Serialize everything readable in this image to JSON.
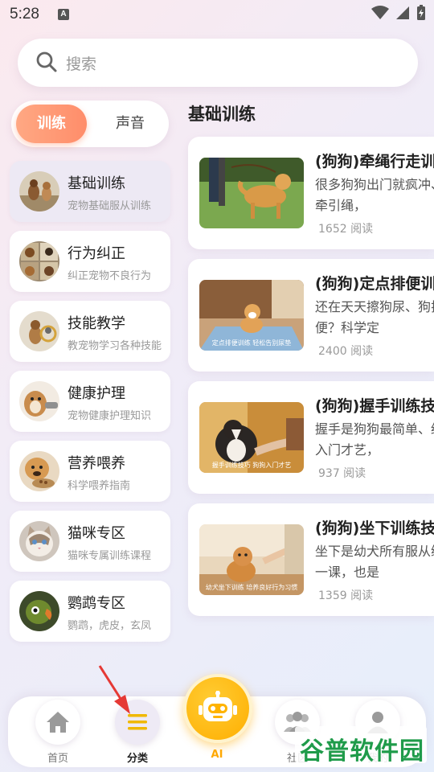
{
  "status": {
    "time": "5:28",
    "notif": "A"
  },
  "search": {
    "placeholder": "搜索"
  },
  "segment": {
    "train": "训练",
    "sound": "声音"
  },
  "categories": [
    {
      "title": "基础训练",
      "subtitle": "宠物基础服从训练",
      "active": true
    },
    {
      "title": "行为纠正",
      "subtitle": "纠正宠物不良行为"
    },
    {
      "title": "技能教学",
      "subtitle": "教宠物学习各种技能"
    },
    {
      "title": "健康护理",
      "subtitle": "宠物健康护理知识"
    },
    {
      "title": "营养喂养",
      "subtitle": "科学喂养指南"
    },
    {
      "title": "猫咪专区",
      "subtitle": "猫咪专属训练课程"
    },
    {
      "title": "鹦鹉专区",
      "subtitle": "鹦鹉，虎皮，玄凤"
    }
  ],
  "main": {
    "section_title": "基础训练"
  },
  "articles": [
    {
      "title": "(狗狗)牵绳行走训",
      "desc": "很多狗狗出门就疯冲、拉扯牵引绳，",
      "reads": "1652 阅读",
      "caption": ""
    },
    {
      "title": "(狗狗)定点排便训",
      "desc": "还在天天擦狗尿、狗拉的便便？科学定",
      "reads": "2400 阅读",
      "caption": "定点排便训练 轻松告别尿垫"
    },
    {
      "title": "(狗狗)握手训练技",
      "desc": "握手是狗狗最简单、经典的入门才艺，",
      "reads": "937 阅读",
      "caption": "握手训练技巧 狗狗入门才艺"
    },
    {
      "title": "(狗狗)坐下训练技",
      "desc": "坐下是幼犬所有服从练的第一课，也是",
      "reads": "1359 阅读",
      "caption": "幼犬坐下训练 培养良好行为习惯"
    }
  ],
  "nav": {
    "home": "首页",
    "category": "分类",
    "ai": "AI",
    "community": "社区",
    "mine": "我的"
  },
  "watermark": "谷普软件园",
  "colors": {
    "accent_orange": "#ff8d6a",
    "ai_yellow": "#ffae00",
    "watermark_green": "#1f9b4a"
  }
}
